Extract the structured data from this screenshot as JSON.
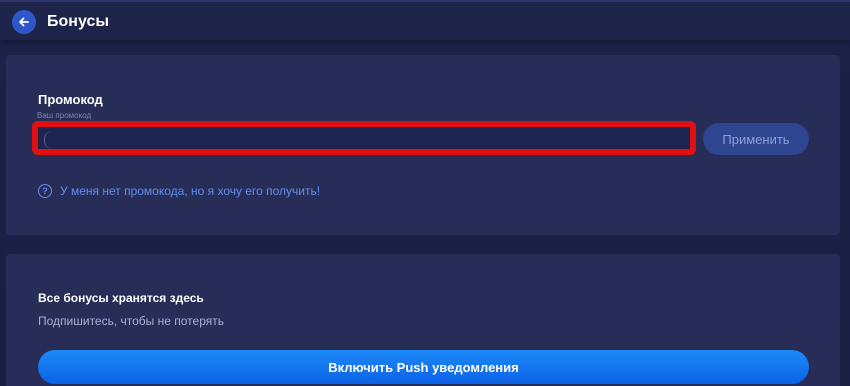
{
  "header": {
    "title": "Бонусы",
    "back_icon": "arrow-left-icon"
  },
  "promo": {
    "heading": "Промокод",
    "field_label": "Ваш промокод",
    "input_value": "",
    "apply_label": "Применить",
    "help_icon_glyph": "?",
    "help_link_text": "У меня нет промокода, но я хочу его получить!"
  },
  "push": {
    "heading": "Все бонусы хранятся здесь",
    "subtitle": "Подпишитесь, чтобы не потерять",
    "button_label": "Включить Push уведомления"
  },
  "colors": {
    "background": "#1a1f45",
    "card": "#272d57",
    "accent_blue": "#1d8af7",
    "link": "#5f8ff0",
    "highlight_red": "#e00f10"
  }
}
